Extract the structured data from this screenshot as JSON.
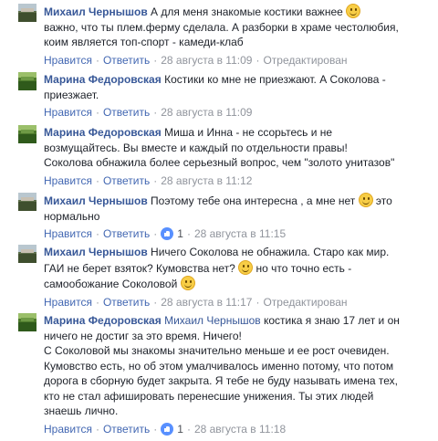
{
  "actions": {
    "like": "Нравится",
    "reply": "Ответить",
    "edited": "Отредактирован",
    "separator": "·"
  },
  "comments": [
    {
      "author": "Михаил Чернышов",
      "lines": [
        "А для меня знакомые костики важнее",
        "важно, что ты плем.ферму сделала. А разборки в храме честолюбия,",
        "коим является топ-спорт - камеди-клаб"
      ],
      "time": "28 августа в 11:09",
      "likes": null,
      "edited": true
    },
    {
      "author": "Марина Федоровская",
      "lines": [
        "Костики ко мне не приезжают. А Соколова -",
        "приезжает."
      ],
      "time": "28 августа в 11:09",
      "likes": null,
      "edited": false
    },
    {
      "author": "Марина Федоровская",
      "lines": [
        "Миша и Инна - не ссорьтесь и не",
        "возмущайтесь. Вы вместе и каждый по отдельности правы!",
        "Соколова обнажила более серьезный вопрос, чем \"золото унитазов\""
      ],
      "time": "28 августа в 11:12",
      "likes": null,
      "edited": false
    },
    {
      "author": "Михаил Чернышов",
      "lines": [
        "Поэтому тебе она интересна , а мне нет",
        "это",
        "нормально"
      ],
      "time": "28 августа в 11:15",
      "likes": "1",
      "edited": false
    },
    {
      "author": "Михаил Чернышов",
      "lines": [
        "Ничего Соколова не обнажила. Старо как мир.",
        "ГАИ не берет взяток? Кумовства нет?",
        "но что точно есть -",
        "самообожание Соколовой"
      ],
      "time": "28 августа в 11:17",
      "likes": null,
      "edited": true
    },
    {
      "author": "Марина Федоровская",
      "mention": "Михаил Чернышов",
      "lines": [
        "костика я знаю 17 лет и он",
        "ничего не достиг за это время. Ничего!",
        "С Соколовой мы знакомы значительно меньше и ее рост очевиден.",
        "Кумовство есть, но об этом умалчивалось именно потому, что потом",
        "дорога в сборную будет закрыта. Я тебе не буду называть имена тех,",
        "кто не стал афишировать перенесшие унижения. Ты этих людей",
        "знаешь лично."
      ],
      "time": "28 августа в 11:18",
      "likes": "1",
      "edited": false
    }
  ]
}
